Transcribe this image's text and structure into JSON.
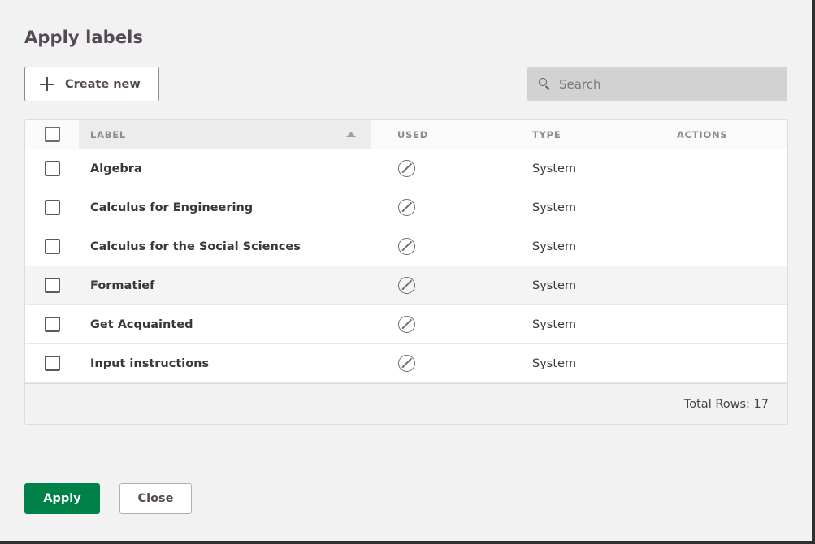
{
  "dialog": {
    "title": "Apply labels"
  },
  "toolbar": {
    "create_label": "Create new",
    "create_icon": "plus-icon",
    "search_placeholder": "Search",
    "search_value": "",
    "search_icon": "search-icon"
  },
  "table": {
    "columns": {
      "label": "LABEL",
      "used": "USED",
      "type": "TYPE",
      "actions": "ACTIONS"
    },
    "sort": {
      "column": "LABEL",
      "direction": "ascending",
      "icon": "sort-ascending-icon"
    },
    "select_all_checked": false,
    "used_icon": "not-used-icon",
    "rows": [
      {
        "label": "Algebra",
        "used": "",
        "type": "System",
        "checked": false,
        "hovered": false
      },
      {
        "label": "Calculus for Engineering",
        "used": "",
        "type": "System",
        "checked": false,
        "hovered": false
      },
      {
        "label": "Calculus for the Social Sciences",
        "used": "",
        "type": "System",
        "checked": false,
        "hovered": false
      },
      {
        "label": "Formatief",
        "used": "",
        "type": "System",
        "checked": false,
        "hovered": true
      },
      {
        "label": "Get Acquainted",
        "used": "",
        "type": "System",
        "checked": false,
        "hovered": false
      },
      {
        "label": "Input instructions",
        "used": "",
        "type": "System",
        "checked": false,
        "hovered": false
      }
    ],
    "footer": {
      "total_rows": "Total Rows: 17"
    }
  },
  "actions": {
    "apply_label": "Apply",
    "close_label": "Close"
  },
  "colors": {
    "primary": "#00814a",
    "title": "#554a54",
    "background": "#f2f2f2",
    "header_sorted": "#ececec",
    "row_hover": "#f4f4f4"
  }
}
